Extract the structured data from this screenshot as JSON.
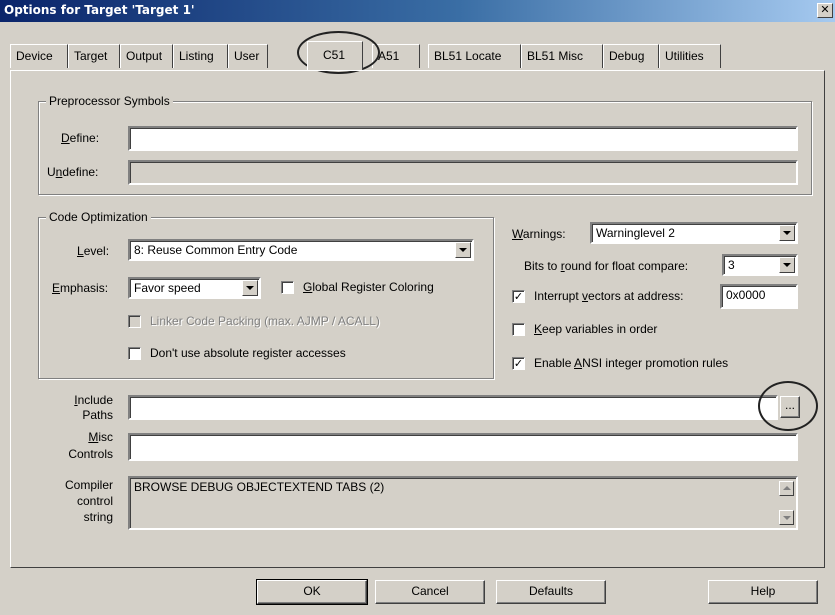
{
  "window": {
    "title": "Options for Target 'Target 1'"
  },
  "icons": {
    "close": "close-icon",
    "dropdown": "chevron-down-icon"
  },
  "tabs": [
    {
      "label": "Device"
    },
    {
      "label": "Target"
    },
    {
      "label": "Output"
    },
    {
      "label": "Listing"
    },
    {
      "label": "User"
    },
    {
      "label": "C51",
      "active": true
    },
    {
      "label": "A51"
    },
    {
      "label": "BL51 Locate"
    },
    {
      "label": "BL51 Misc"
    },
    {
      "label": "Debug"
    },
    {
      "label": "Utilities"
    }
  ],
  "preprocessor": {
    "title": "Preprocessor Symbols",
    "define_label_pre": "",
    "define_label_ul": "D",
    "define_label_post": "efine:",
    "define_value": "",
    "undefine_label_pre": "U",
    "undefine_label_ul": "n",
    "undefine_label_post": "define:",
    "undefine_value": ""
  },
  "optimization": {
    "title": "Code Optimization",
    "level_label_ul": "L",
    "level_label_post": "evel:",
    "level_value": "8: Reuse Common Entry Code",
    "emphasis_label_ul": "E",
    "emphasis_label_post": "mphasis:",
    "emphasis_value": "Favor speed",
    "global_reg_ul": "G",
    "global_reg_post": "lobal Register Coloring",
    "global_reg_checked": false,
    "linker_packing_label": "Linker Code Packing (max. AJMP / ACALL)",
    "linker_packing_checked": false,
    "absolute_reg_label": "Don't use absolute register accesses",
    "absolute_reg_checked": false
  },
  "warnings": {
    "label_ul": "W",
    "label_post": "arnings:",
    "value": "Warninglevel 2",
    "bits_label_pre": "Bits to ",
    "bits_label_ul": "r",
    "bits_label_post": "ound for float compare:",
    "bits_value": "3",
    "interrupt_label_pre": "Interrupt ",
    "interrupt_label_ul": "v",
    "interrupt_label_post": "ectors at address:",
    "interrupt_checked": true,
    "interrupt_address": "0x0000",
    "keep_vars_ul": "K",
    "keep_vars_post": "eep variables in order",
    "keep_vars_checked": false,
    "ansi_pre": "Enable ",
    "ansi_ul": "A",
    "ansi_post": "NSI integer promotion rules",
    "ansi_checked": true
  },
  "paths": {
    "include_label_ul": "I",
    "include_label_post": "nclude",
    "include_label_2": "Paths",
    "include_value": "",
    "browse_label": "...",
    "misc_label_ul": "M",
    "misc_label_post": "isc",
    "misc_label_2": "Controls",
    "misc_value": "",
    "compiler_label_1": "Compiler",
    "compiler_label_2": "control",
    "compiler_label_3": "string",
    "compiler_value": "BROWSE DEBUG OBJECTEXTEND TABS (2)"
  },
  "buttons": {
    "ok": "OK",
    "cancel": "Cancel",
    "defaults": "Defaults",
    "help": "Help"
  },
  "check_mark": "✓"
}
